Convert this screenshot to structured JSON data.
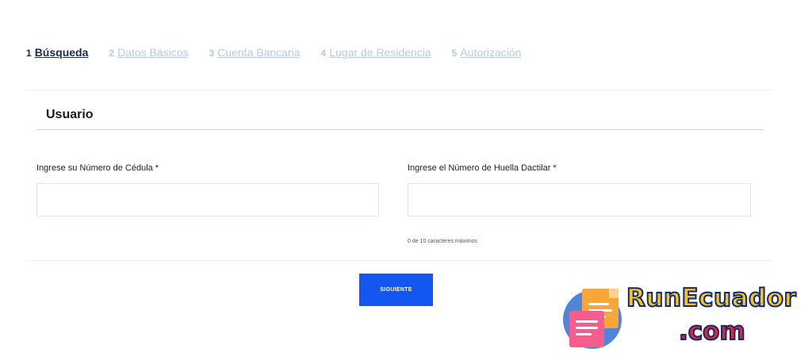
{
  "steps": [
    {
      "num": "1",
      "label": "Búsqueda",
      "active": true
    },
    {
      "num": "2",
      "label": "Datos Básicos",
      "active": false
    },
    {
      "num": "3",
      "label": "Cuenta Bancaria",
      "active": false
    },
    {
      "num": "4",
      "label": "Lugar de Residencia",
      "active": false
    },
    {
      "num": "5",
      "label": "Autorización",
      "active": false
    }
  ],
  "section": {
    "title": "Usuario"
  },
  "form": {
    "cedula": {
      "label": "Ingrese su Número de Cédula *",
      "value": "",
      "placeholder": ""
    },
    "huella": {
      "label": "Ingrese el Número de Huella Dactilar *",
      "value": "",
      "placeholder": "",
      "helper": "0 de 10 caracteres máximos"
    }
  },
  "actions": {
    "next_label": "SIGUIENTE"
  },
  "watermark": {
    "line1": "RunEcuador",
    "line2": ".com"
  },
  "colors": {
    "primary": "#1356f2",
    "active_step": "#1b2a52",
    "inactive_step": "#b8c9e6"
  }
}
